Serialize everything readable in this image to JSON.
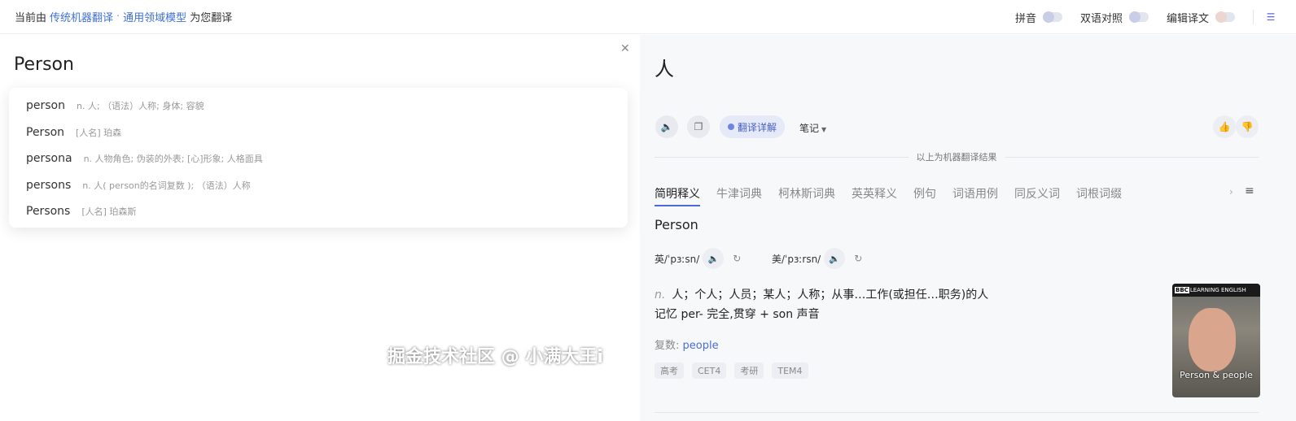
{
  "topbar": {
    "prefix": "当前由",
    "engine": "传统机器翻译",
    "dot": "·",
    "model": "通用领域模型",
    "suffix": "为您翻译",
    "pinyin_label": "拼音",
    "bilingual_label": "双语对照",
    "edit_label": "编辑译文",
    "menu_icon": "list-icon"
  },
  "source": {
    "text": "Person",
    "close_icon": "close-icon"
  },
  "suggestions": [
    {
      "word": "person",
      "def": "n. 人; （语法）人称; 身体; 容貌"
    },
    {
      "word": "Person",
      "def": "[人名] 珀森"
    },
    {
      "word": "persona",
      "def": "n. 人物角色; 伪装的外表; [心]形象; 人格面具"
    },
    {
      "word": "persons",
      "def": "n. 人( person的名词复数 ); （语法）人称"
    },
    {
      "word": "Persons",
      "def": "[人名] 珀森斯"
    }
  ],
  "target": {
    "text": "人",
    "detail_label": "翻译详解",
    "notes_label": "笔记",
    "machine_note": "以上为机器翻译结果"
  },
  "dict_tabs": [
    "简明释义",
    "牛津词典",
    "柯林斯词典",
    "英英释义",
    "例句",
    "词语用例",
    "同反义词",
    "词根词缀"
  ],
  "entry": {
    "headword": "Person",
    "uk_label": "英/ˈpɜːsn/",
    "us_label": "美/ˈpɜːrsn/",
    "pos": "n.",
    "definition": "人；个人；人员；某人；人称；从事…工作(或担任…职务)的人",
    "memory": "记忆  per- 完全,贯穿 + son 声音",
    "plural_label": "复数:",
    "plural_value": "people",
    "tags": [
      "高考",
      "CET4",
      "考研",
      "TEM4"
    ]
  },
  "video": {
    "brand": "BBC",
    "brand_sub": "LEARNING ENGLISH",
    "caption": "Person & people"
  },
  "watermark": "掘金技术社区 @ 小满大王i"
}
